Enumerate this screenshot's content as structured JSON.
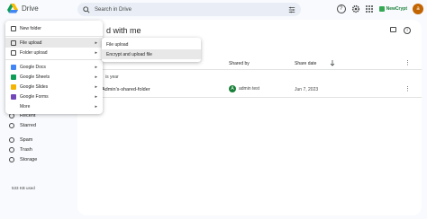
{
  "app": {
    "title": "Drive"
  },
  "search": {
    "placeholder": "Search in Drive"
  },
  "header": {
    "brand": "NewCrypt",
    "avatar_letter": "a"
  },
  "sidebar": {
    "items": [
      {
        "label": "Recent",
        "icon": "clock-icon"
      },
      {
        "label": "Starred",
        "icon": "star-icon"
      },
      {
        "label": "Spam",
        "icon": "spam-icon"
      },
      {
        "label": "Trash",
        "icon": "trash-icon"
      },
      {
        "label": "Storage",
        "icon": "cloud-icon"
      }
    ],
    "storage_used": "533 KB used"
  },
  "main": {
    "title": "d with me",
    "columns": {
      "shared_by": "Shared by",
      "share_date": "Share date"
    },
    "section": "is year",
    "rows": [
      {
        "name": "Admin's-shared-folder",
        "owner": "admin test",
        "owner_initial": "A",
        "date": "Jun 7, 2023"
      }
    ]
  },
  "new_menu": {
    "items": [
      {
        "label": "New folder",
        "icon": "folder-plus-icon",
        "submenu": false
      },
      {
        "label": "File upload",
        "icon": "file-upload-icon",
        "submenu": true,
        "highlighted": true
      },
      {
        "label": "Folder upload",
        "icon": "folder-upload-icon",
        "submenu": true
      },
      {
        "label": "Google Docs",
        "icon": "docs-icon",
        "color": "#4285f4",
        "submenu": true
      },
      {
        "label": "Google Sheets",
        "icon": "sheets-icon",
        "color": "#0f9d58",
        "submenu": true
      },
      {
        "label": "Google Slides",
        "icon": "slides-icon",
        "color": "#f4b400",
        "submenu": true
      },
      {
        "label": "Google Forms",
        "icon": "forms-icon",
        "color": "#7248b9",
        "submenu": true
      },
      {
        "label": "More",
        "icon": "",
        "submenu": true
      }
    ]
  },
  "upload_submenu": {
    "items": [
      {
        "label": "File upload"
      },
      {
        "label": "Encrypt and upload file",
        "highlighted": true
      }
    ]
  }
}
